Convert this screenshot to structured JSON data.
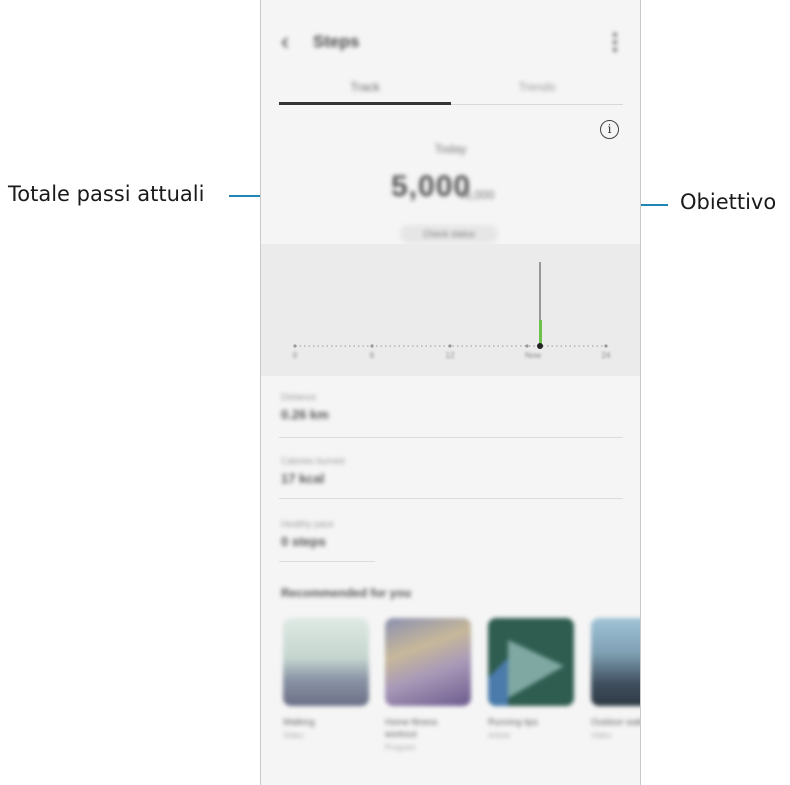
{
  "callouts": {
    "left_label": "Totale passi attuali",
    "right_label": "Obiettivo"
  },
  "app": {
    "back_icon": "‹",
    "title": "Steps",
    "more_icon": "⋮"
  },
  "tabs": [
    {
      "label": "Track",
      "selected": true
    },
    {
      "label": "Trends",
      "selected": false
    }
  ],
  "summary": {
    "info_icon": "i",
    "day": "Today",
    "steps": "5,000",
    "goal": "/6,000",
    "goal_button": "Check status"
  },
  "chart": {
    "x_labels": [
      "0",
      "6",
      "12",
      "Now",
      "24"
    ]
  },
  "stats": [
    {
      "label": "Distance",
      "value": "0.26 km"
    },
    {
      "label": "Calories burned",
      "value": "17 kcal"
    },
    {
      "label": "Healthy pace",
      "value": "0 steps"
    }
  ],
  "recommended": {
    "title": "Recommended for you",
    "cards": [
      {
        "title": "Walking",
        "subtitle": "Video"
      },
      {
        "title": "Home fitness workout",
        "subtitle": "Program"
      },
      {
        "title": "Running tips",
        "subtitle": "Article"
      },
      {
        "title": "Outdoor walks",
        "subtitle": "Video"
      }
    ]
  },
  "colors": {
    "callout_line": "#1f86b5",
    "chart_bar": "#6cc24a"
  }
}
